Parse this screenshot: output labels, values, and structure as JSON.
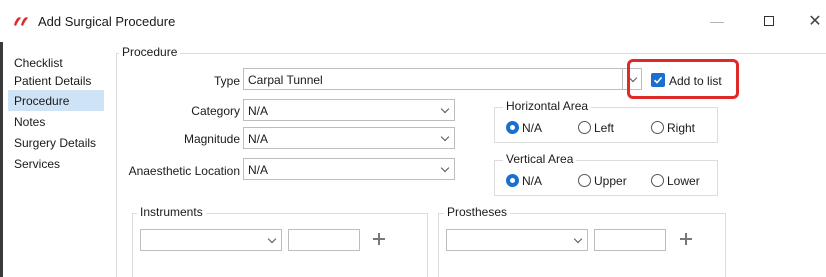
{
  "window": {
    "title": "Add Surgical Procedure",
    "controls": {
      "minimize": "—",
      "close": "✕"
    }
  },
  "sidebar": {
    "items": [
      {
        "label": "Checklist",
        "active": false
      },
      {
        "label": "Patient Details",
        "active": false
      },
      {
        "label": "Procedure",
        "active": true
      },
      {
        "label": "Notes",
        "active": false
      },
      {
        "label": "Surgery Details",
        "active": false
      },
      {
        "label": "Services",
        "active": false
      }
    ]
  },
  "procedure": {
    "group_label": "Procedure",
    "type": {
      "label": "Type",
      "value": "Carpal Tunnel"
    },
    "add_to_list": {
      "label": "Add to list",
      "checked": true
    },
    "category": {
      "label": "Category",
      "value": "N/A"
    },
    "magnitude": {
      "label": "Magnitude",
      "value": "N/A"
    },
    "anaesthetic_location": {
      "label": "Anaesthetic Location",
      "value": "N/A"
    },
    "horizontal_area": {
      "label": "Horizontal Area",
      "options": [
        "N/A",
        "Left",
        "Right"
      ],
      "selected": "N/A"
    },
    "vertical_area": {
      "label": "Vertical Area",
      "options": [
        "N/A",
        "Upper",
        "Lower"
      ],
      "selected": "N/A"
    }
  },
  "instruments": {
    "label": "Instruments",
    "value": "",
    "quantity": ""
  },
  "prostheses": {
    "label": "Prostheses",
    "value": "",
    "quantity": ""
  },
  "colors": {
    "accent": "#1a6fd0",
    "highlight": "#e02a2a",
    "nav_active": "#cfe3f7"
  }
}
